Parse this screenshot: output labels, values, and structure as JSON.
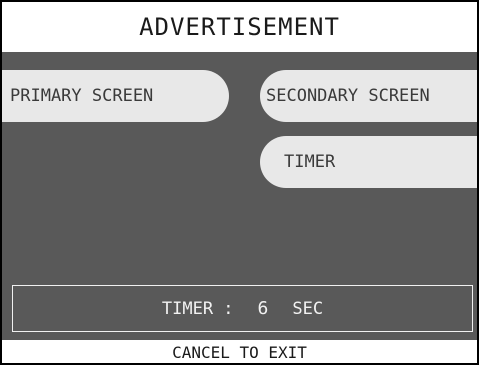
{
  "header": {
    "title": "ADVERTISEMENT"
  },
  "buttons": {
    "primary_screen": "PRIMARY SCREEN",
    "secondary_screen": "SECONDARY SCREEN",
    "timer": "TIMER"
  },
  "timer_display": {
    "label": "TIMER :",
    "value": "6",
    "unit": "SEC"
  },
  "footer": {
    "instruction": "CANCEL TO EXIT"
  },
  "colors": {
    "background": "#595959",
    "button": "#e8e8e8",
    "header_bg": "#ffffff"
  }
}
